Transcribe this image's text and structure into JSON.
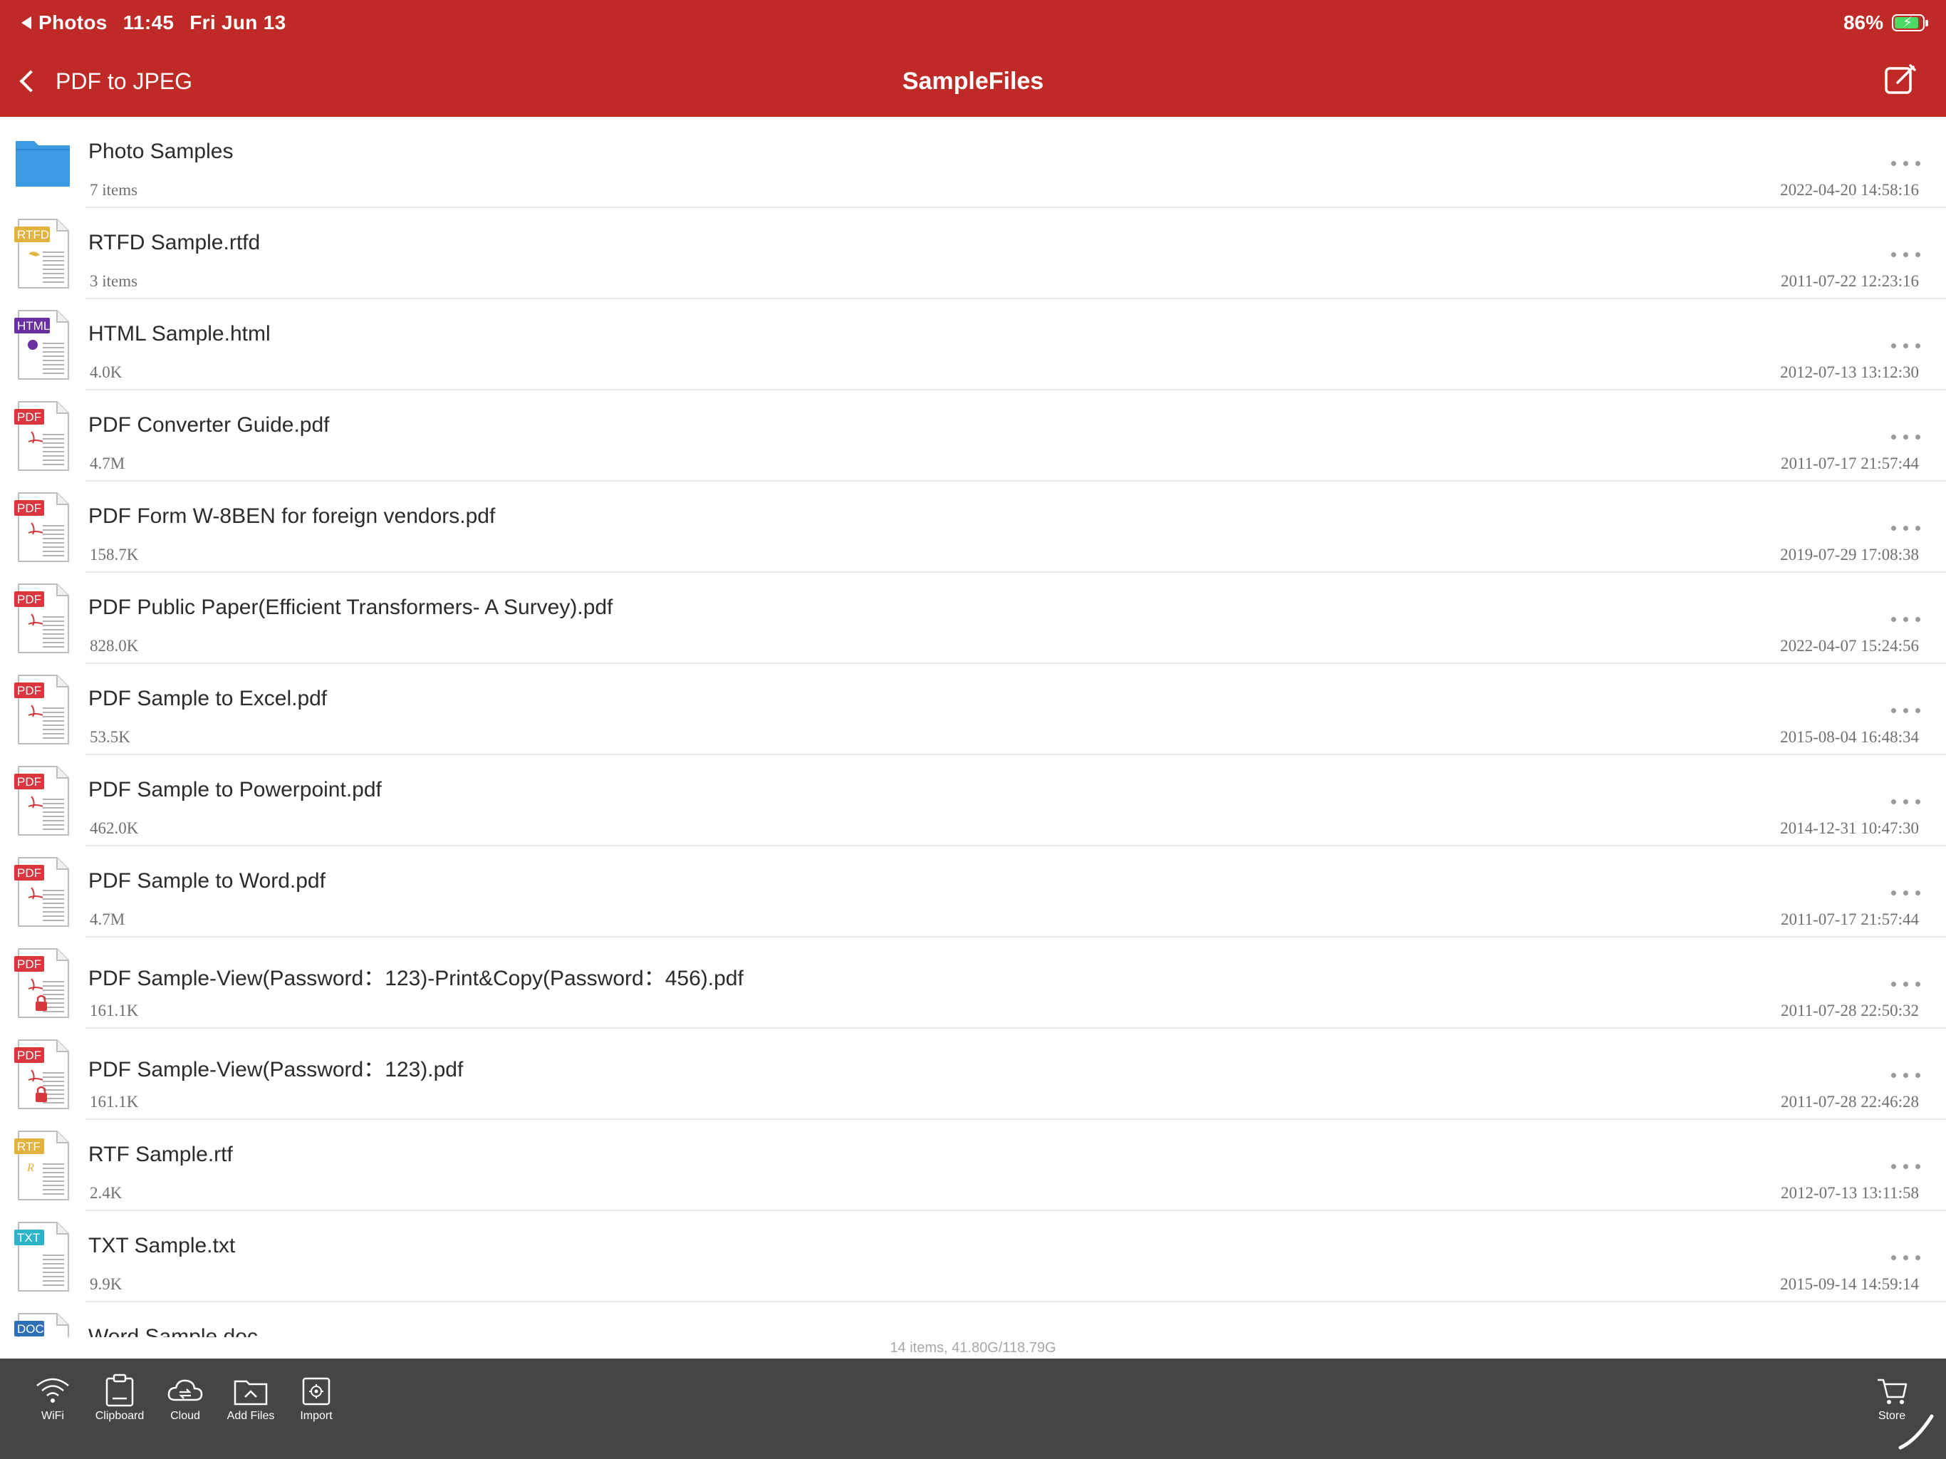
{
  "status_bar": {
    "back_app": "Photos",
    "time": "11:45",
    "date": "Fri Jun 13",
    "battery": "86%"
  },
  "nav": {
    "back_label": "PDF to JPEG",
    "title": "SampleFiles"
  },
  "files": [
    {
      "name": "Photo Samples",
      "meta": "7 items",
      "date": "2022-04-20 14:58:16",
      "kind": "folder"
    },
    {
      "name": "RTFD Sample.rtfd",
      "meta": "3 items",
      "date": "2011-07-22 12:23:16",
      "kind": "RTFD"
    },
    {
      "name": "HTML Sample.html",
      "meta": "4.0K",
      "date": "2012-07-13 13:12:30",
      "kind": "HTML"
    },
    {
      "name": "PDF Converter Guide.pdf",
      "meta": "4.7M",
      "date": "2011-07-17 21:57:44",
      "kind": "PDF"
    },
    {
      "name": "PDF Form W-8BEN for foreign vendors.pdf",
      "meta": "158.7K",
      "date": "2019-07-29 17:08:38",
      "kind": "PDF"
    },
    {
      "name": "PDF Public Paper(Efficient Transformers- A Survey).pdf",
      "meta": "828.0K",
      "date": "2022-04-07 15:24:56",
      "kind": "PDF"
    },
    {
      "name": "PDF Sample to Excel.pdf",
      "meta": "53.5K",
      "date": "2015-08-04 16:48:34",
      "kind": "PDF"
    },
    {
      "name": "PDF Sample to Powerpoint.pdf",
      "meta": "462.0K",
      "date": "2014-12-31 10:47:30",
      "kind": "PDF"
    },
    {
      "name": "PDF Sample to Word.pdf",
      "meta": "4.7M",
      "date": "2011-07-17 21:57:44",
      "kind": "PDF"
    },
    {
      "name": "PDF Sample-View(Password：123)-Print&Copy(Password：456).pdf",
      "meta": "161.1K",
      "date": "2011-07-28 22:50:32",
      "kind": "PDF-locked"
    },
    {
      "name": "PDF Sample-View(Password：123).pdf",
      "meta": "161.1K",
      "date": "2011-07-28 22:46:28",
      "kind": "PDF-locked"
    },
    {
      "name": "RTF Sample.rtf",
      "meta": "2.4K",
      "date": "2012-07-13 13:11:58",
      "kind": "RTF"
    },
    {
      "name": "TXT Sample.txt",
      "meta": "9.9K",
      "date": "2015-09-14 14:59:14",
      "kind": "TXT"
    },
    {
      "name": "Word Sample.doc",
      "meta": "",
      "date": "",
      "kind": "DOC"
    }
  ],
  "summary": "14 items, 41.80G/118.79G",
  "toolbar": {
    "wifi": "WiFi",
    "clipboard": "Clipboard",
    "cloud": "Cloud",
    "add_files": "Add Files",
    "import": "Import",
    "store": "Store"
  },
  "colors": {
    "header_red": "#bf2a26",
    "folder_blue": "#3b9ae1",
    "pdf_red": "#d9363e",
    "rtfd_gold": "#e3b23c",
    "html_purple": "#6a2fa3",
    "txt_teal": "#2ab3c9",
    "doc_blue": "#2f6fb5",
    "toolbar_gray": "#454545"
  },
  "icons": {
    "back": "chevron-left-icon",
    "edit": "compose-icon",
    "row_more": "ellipsis-icon",
    "wifi": "wifi-icon",
    "clipboard": "clipboard-icon",
    "cloud": "cloud-icon",
    "add_files": "folder-upload-icon",
    "import": "import-icon",
    "store": "cart-icon"
  }
}
